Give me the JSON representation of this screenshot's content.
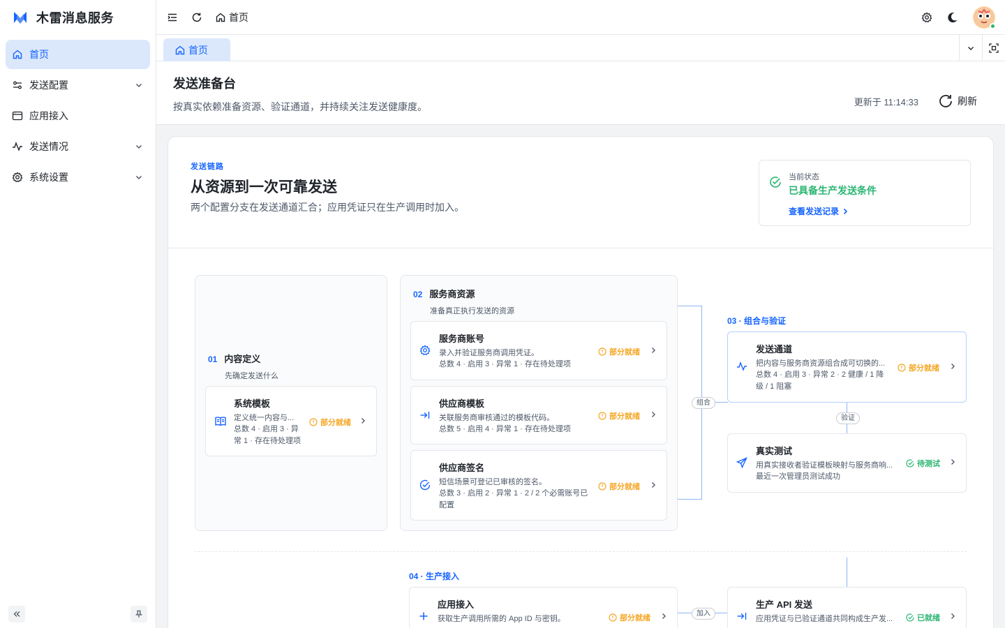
{
  "sidebar": {
    "brand": "木雷消息服务",
    "items": [
      {
        "label": "首页",
        "icon": "home-icon",
        "active": true
      },
      {
        "label": "发送配置",
        "icon": "sliders-icon",
        "expandable": true
      },
      {
        "label": "应用接入",
        "icon": "window-icon"
      },
      {
        "label": "发送情况",
        "icon": "activity-icon",
        "expandable": true
      },
      {
        "label": "系统设置",
        "icon": "gear-icon",
        "expandable": true
      }
    ]
  },
  "topbar": {
    "crumb": "首页"
  },
  "tabs": [
    {
      "label": "首页",
      "active": true
    }
  ],
  "page": {
    "title": "发送准备台",
    "desc": "按真实依赖准备资源、验证通道，并持续关注发送健康度。",
    "updated": "更新于 11:14:33",
    "refresh": "刷新"
  },
  "hero": {
    "kicker": "发送链路",
    "title": "从资源到一次可靠发送",
    "desc": "两个配置分支在发送通道汇合；应用凭证只在生产调用时加入。",
    "status_label": "当前状态",
    "status_value": "已具备生产发送条件",
    "status_link": "查看发送记录"
  },
  "flow": {
    "sec01": {
      "num": "01",
      "title": "内容定义",
      "sub": "先确定发送什么"
    },
    "sec02": {
      "num": "02",
      "title": "服务商资源",
      "sub": "准备真正执行发送的资源"
    },
    "sec03": "03 · 组合与验证",
    "sec04": "04 · 生产接入",
    "connectors": {
      "combine": "组合",
      "verify": "验证",
      "join": "加入"
    },
    "cards": {
      "system_template": {
        "title": "系统模板",
        "desc": "定义统一内容与...",
        "meta": "总数 4 · 启用 3 · 异常 1 · 存在待处理项",
        "status": "部分就绪"
      },
      "provider_account": {
        "title": "服务商账号",
        "desc": "录入并验证服务商调用凭证。",
        "meta": "总数 4 · 启用 3 · 异常 1 · 存在待处理项",
        "status": "部分就绪"
      },
      "provider_template": {
        "title": "供应商模板",
        "desc": "关联服务商审核通过的模板代码。",
        "meta": "总数 5 · 启用 4 · 异常 1 · 存在待处理项",
        "status": "部分就绪"
      },
      "provider_signature": {
        "title": "供应商签名",
        "desc": "短信场景可登记已审核的签名。",
        "meta": "总数 3 · 启用 2 · 异常 1 · 2 / 2 个必需账号已配置",
        "status": "部分就绪"
      },
      "send_channel": {
        "title": "发送通道",
        "desc": "把内容与服务商资源组合成可切换的...",
        "meta": "总数 4 · 启用 3 · 异常 2 · 2 健康 / 1 降级 / 1 阻塞",
        "status": "部分就绪"
      },
      "real_test": {
        "title": "真实测试",
        "desc": "用真实接收者验证模板映射与服务商响...",
        "meta": "最近一次管理员测试成功",
        "status": "待测试"
      },
      "app_access": {
        "title": "应用接入",
        "desc": "获取生产调用所需的 App ID 与密钥。",
        "status": "部分就绪"
      },
      "prod_api": {
        "title": "生产 API 发送",
        "desc": "应用凭证与已验证通道共同构成生产发...",
        "status": "已就绪"
      }
    }
  },
  "colors": {
    "accent": "#1664ff",
    "active_bg": "#dbe8fc",
    "warning": "#f5a623",
    "success": "#2bb673"
  }
}
